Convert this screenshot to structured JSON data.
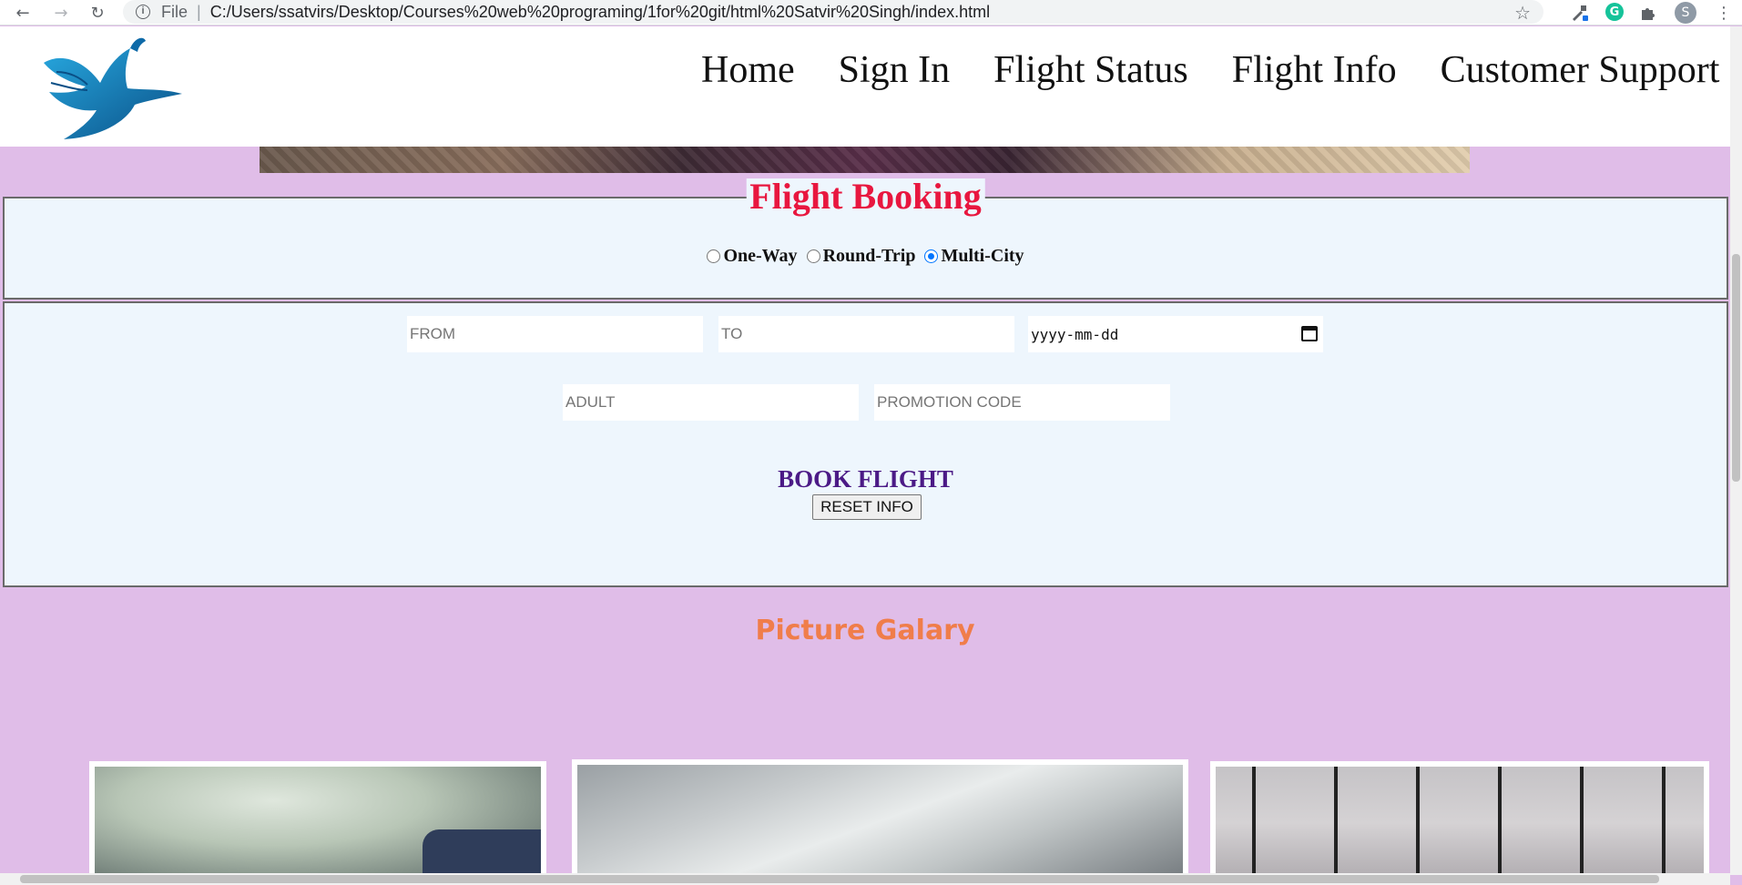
{
  "browser": {
    "back_icon": "←",
    "forward_icon": "→",
    "reload_icon": "↻",
    "info_icon": "i",
    "file_label": "File",
    "separator": "|",
    "url": "C:/Users/ssatvirs/Desktop/Courses%20web%20programing/1for%20git/html%20Satvir%20Singh/index.html",
    "star_icon": "☆",
    "grammarly_icon": "G",
    "avatar_initial": "S",
    "menu_icon": "⋮"
  },
  "nav": {
    "items": [
      "Home",
      "Sign In",
      "Flight Status",
      "Flight Info",
      "Customer Support"
    ]
  },
  "booking": {
    "legend": "Flight Booking",
    "trip_types": [
      {
        "label": "One-Way",
        "checked": false
      },
      {
        "label": "Round-Trip",
        "checked": false
      },
      {
        "label": "Multi-City",
        "checked": true
      }
    ],
    "from_placeholder": "FROM",
    "to_placeholder": "TO",
    "date_placeholder": "yyyy-mm-dd",
    "adult_placeholder": "ADULT",
    "promo_placeholder": "PROMOTION CODE",
    "book_label": "BOOK FLIGHT",
    "reset_label": "RESET INFO"
  },
  "gallery": {
    "title": "Picture Galary"
  },
  "colors": {
    "page_background": "#e0bde8",
    "fieldset_background": "#eef6fd",
    "legend_color": "#e8173f",
    "book_color": "#4b1a86",
    "gallery_title_color": "#f07d4a",
    "radio_accent": "#0075ff",
    "logo_blue": "#1a86c8"
  }
}
